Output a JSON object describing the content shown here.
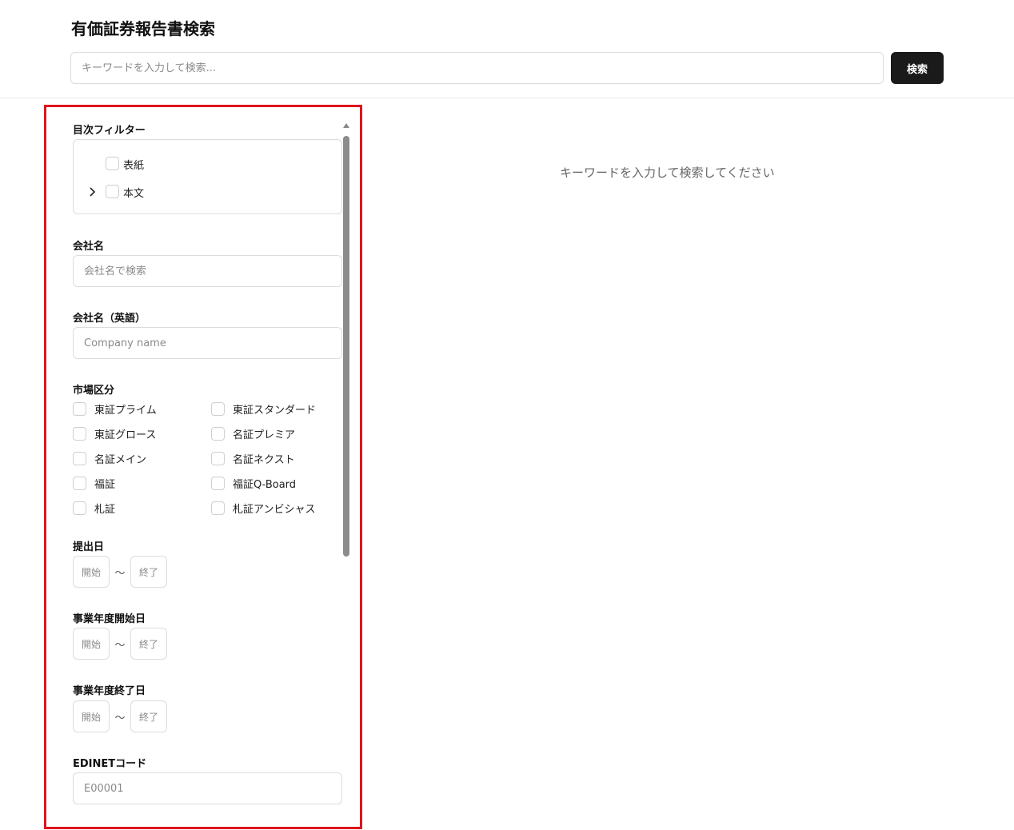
{
  "header": {
    "title": "有価証券報告書検索",
    "search_placeholder": "キーワードを入力して検索...",
    "search_button": "検索"
  },
  "sidebar": {
    "toc_filter": {
      "label": "目次フィルター",
      "items": [
        {
          "label": "表紙",
          "expandable": false
        },
        {
          "label": "本文",
          "expandable": true
        }
      ]
    },
    "company_name": {
      "label": "会社名",
      "placeholder": "会社名で検索"
    },
    "company_name_en": {
      "label": "会社名（英語）",
      "placeholder": "Company name"
    },
    "market": {
      "label": "市場区分",
      "items": [
        "東証プライム",
        "東証スタンダード",
        "東証グロース",
        "名証プレミア",
        "名証メイン",
        "名証ネクスト",
        "福証",
        "福証Q-Board",
        "札証",
        "札証アンビシャス"
      ]
    },
    "submit_date": {
      "label": "提出日",
      "start": "開始",
      "separator": "〜",
      "end": "終了"
    },
    "fy_start": {
      "label": "事業年度開始日",
      "start": "開始",
      "separator": "〜",
      "end": "終了"
    },
    "fy_end": {
      "label": "事業年度終了日",
      "start": "開始",
      "separator": "〜",
      "end": "終了"
    },
    "edinet_code": {
      "label": "EDINETコード",
      "placeholder": "E00001"
    }
  },
  "main": {
    "empty_message": "キーワードを入力して検索してください"
  }
}
